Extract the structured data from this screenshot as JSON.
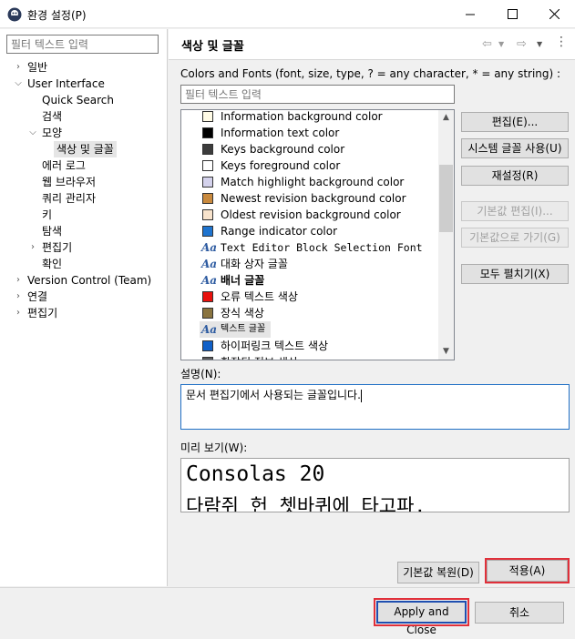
{
  "window": {
    "title": "환경 설정(P)"
  },
  "left": {
    "filter_placeholder": "필터 텍스트 입력",
    "tree": [
      {
        "label": "일반",
        "level": 0,
        "twisty": "closed"
      },
      {
        "label": "User Interface",
        "level": 0,
        "twisty": "open"
      },
      {
        "label": "Quick Search",
        "level": 1,
        "twisty": ""
      },
      {
        "label": "검색",
        "level": 1,
        "twisty": ""
      },
      {
        "label": "모양",
        "level": 1,
        "twisty": "open"
      },
      {
        "label": "색상 및 글꼴",
        "level": 2,
        "twisty": "",
        "selected": true
      },
      {
        "label": "에러 로그",
        "level": 1,
        "twisty": ""
      },
      {
        "label": "웹 브라우저",
        "level": 1,
        "twisty": ""
      },
      {
        "label": "쿼리 관리자",
        "level": 1,
        "twisty": ""
      },
      {
        "label": "키",
        "level": 1,
        "twisty": ""
      },
      {
        "label": "탐색",
        "level": 1,
        "twisty": ""
      },
      {
        "label": "편집기",
        "level": 1,
        "twisty": "closed"
      },
      {
        "label": "확인",
        "level": 1,
        "twisty": ""
      },
      {
        "label": "Version Control (Team)",
        "level": 0,
        "twisty": "closed"
      },
      {
        "label": "연결",
        "level": 0,
        "twisty": "closed"
      },
      {
        "label": "편집기",
        "level": 0,
        "twisty": "closed"
      }
    ]
  },
  "right": {
    "title": "색상 및 글꼴",
    "colors_fonts_label": "Colors and Fonts (font, size, type, ? = any character, * = any string) :",
    "filter_placeholder": "필터 텍스트 입력",
    "items": [
      {
        "kind": "color",
        "color": "#fffbe6",
        "label": "Information background color"
      },
      {
        "kind": "color",
        "color": "#000000",
        "label": "Information text color"
      },
      {
        "kind": "color",
        "color": "#3c3c3c",
        "label": "Keys background color"
      },
      {
        "kind": "color",
        "color": "#ffffff",
        "label": "Keys foreground color"
      },
      {
        "kind": "color",
        "color": "#d4d2ec",
        "label": "Match highlight background color"
      },
      {
        "kind": "color",
        "color": "#c98a3e",
        "label": "Newest revision background color"
      },
      {
        "kind": "color",
        "color": "#f8e3cc",
        "label": "Oldest revision background color"
      },
      {
        "kind": "color",
        "color": "#1f74cf",
        "label": "Range indicator color"
      },
      {
        "kind": "font",
        "label": "Text Editor Block Selection Font",
        "style": "mono"
      },
      {
        "kind": "font",
        "label": "대화 상자 글꼴",
        "style": ""
      },
      {
        "kind": "font",
        "label": "배너 글꼴",
        "style": "bold"
      },
      {
        "kind": "color",
        "color": "#e8110d",
        "label": "오류 텍스트 색상"
      },
      {
        "kind": "color",
        "color": "#8a7440",
        "label": "장식 색상"
      },
      {
        "kind": "font",
        "label": "텍스트 글꼴",
        "style": "",
        "selected": true
      },
      {
        "kind": "color",
        "color": "#1060c8",
        "label": "하이퍼링크 텍스트 색상"
      },
      {
        "kind": "color",
        "color": "#5a5a5a",
        "label": "확장된 정보 색상"
      }
    ],
    "side_buttons": [
      {
        "label": "편집(E)...",
        "enabled": true
      },
      {
        "label": "시스템 글꼴 사용(U)",
        "enabled": true
      },
      {
        "label": "재설정(R)",
        "enabled": true
      },
      {
        "label": "기본값 편집(I)...",
        "enabled": false
      },
      {
        "label": "기본값으로 가기(G)",
        "enabled": false
      },
      {
        "label": "모두 펼치기(X)",
        "enabled": true
      }
    ],
    "description_label": "설명(N):",
    "description_text": "문서 편집기에서 사용되는 글꼴입니다.",
    "preview_label": "미리 보기(W):",
    "preview_line1": "Consolas 20",
    "preview_line2": "다람쥐 헌 쳇바퀴에 타고파.",
    "restore_defaults": "기본값 복원(D)",
    "apply": "적용(A)"
  },
  "footer": {
    "apply_close": "Apply and Close",
    "cancel": "취소"
  }
}
